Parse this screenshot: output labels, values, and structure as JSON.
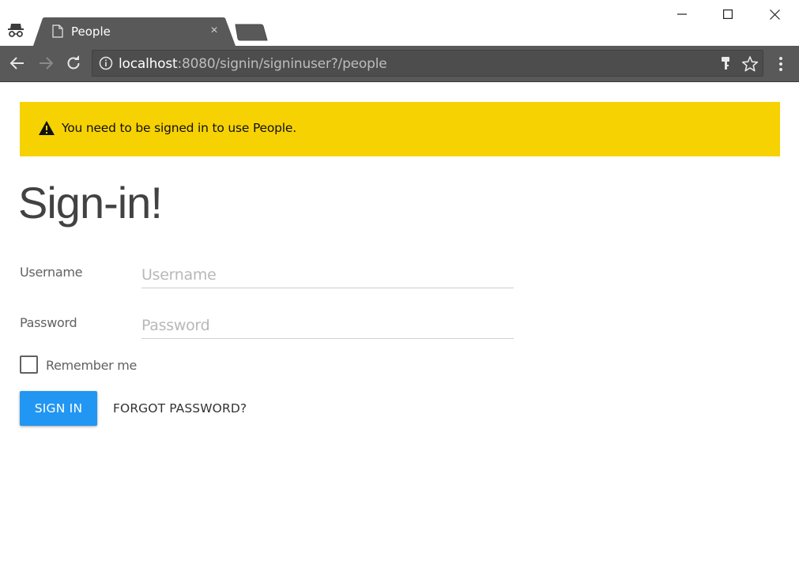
{
  "browser": {
    "tab_title": "People",
    "tab_close_glyph": "×",
    "url_host": "localhost",
    "url_rest": ":8080/signin/signinuser?/people",
    "icons": [
      "incognito-icon",
      "page-icon",
      "back-arrow-icon",
      "forward-arrow-icon",
      "reload-icon",
      "info-icon",
      "key-icon",
      "star-icon",
      "more-vert-icon",
      "minimize-icon",
      "maximize-icon",
      "close-icon"
    ]
  },
  "alert": {
    "message": "You need to be signed in to use People.",
    "color": "#f7d202"
  },
  "page": {
    "heading": "Sign-in!",
    "username_label": "Username",
    "username_value": "",
    "username_placeholder": "Username",
    "password_label": "Password",
    "password_value": "",
    "password_placeholder": "Password",
    "remember_label": "Remember me",
    "remember_checked": false,
    "signin_button": "SIGN IN",
    "forgot_button": "FORGOT PASSWORD?",
    "accent_color": "#2196f3"
  }
}
